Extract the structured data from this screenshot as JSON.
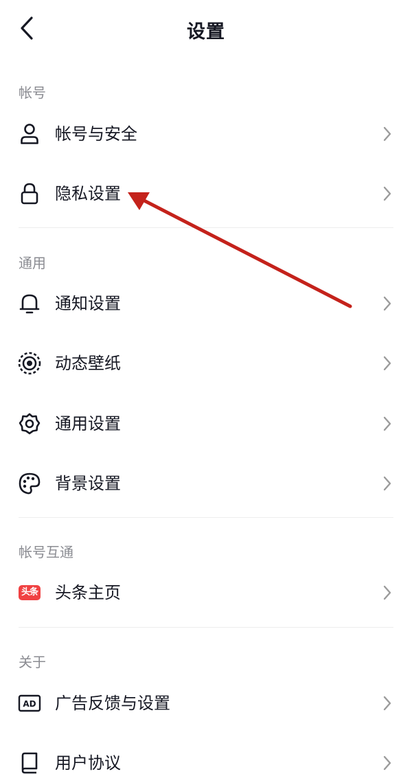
{
  "header": {
    "title": "设置",
    "back_icon": "chevron-left-icon"
  },
  "sections": [
    {
      "label": "帐号",
      "items": [
        {
          "label": "帐号与安全",
          "icon": "user-icon"
        },
        {
          "label": "隐私设置",
          "icon": "lock-icon"
        }
      ]
    },
    {
      "label": "通用",
      "items": [
        {
          "label": "通知设置",
          "icon": "bell-icon"
        },
        {
          "label": "动态壁纸",
          "icon": "live-wallpaper-icon"
        },
        {
          "label": "通用设置",
          "icon": "gear-icon"
        },
        {
          "label": "背景设置",
          "icon": "palette-icon"
        }
      ]
    },
    {
      "label": "帐号互通",
      "items": [
        {
          "label": "头条主页",
          "icon": "toutiao-icon",
          "badge_text": "头条"
        }
      ]
    },
    {
      "label": "关于",
      "items": [
        {
          "label": "广告反馈与设置",
          "icon": "ad-icon",
          "badge_text": "AD"
        },
        {
          "label": "用户协议",
          "icon": "book-icon"
        }
      ]
    }
  ],
  "colors": {
    "text": "#161823",
    "secondary": "#8a8b91",
    "chevron": "#9b9b9b",
    "annotation_arrow": "#c4221b",
    "toutiao_red": "#f04142"
  }
}
